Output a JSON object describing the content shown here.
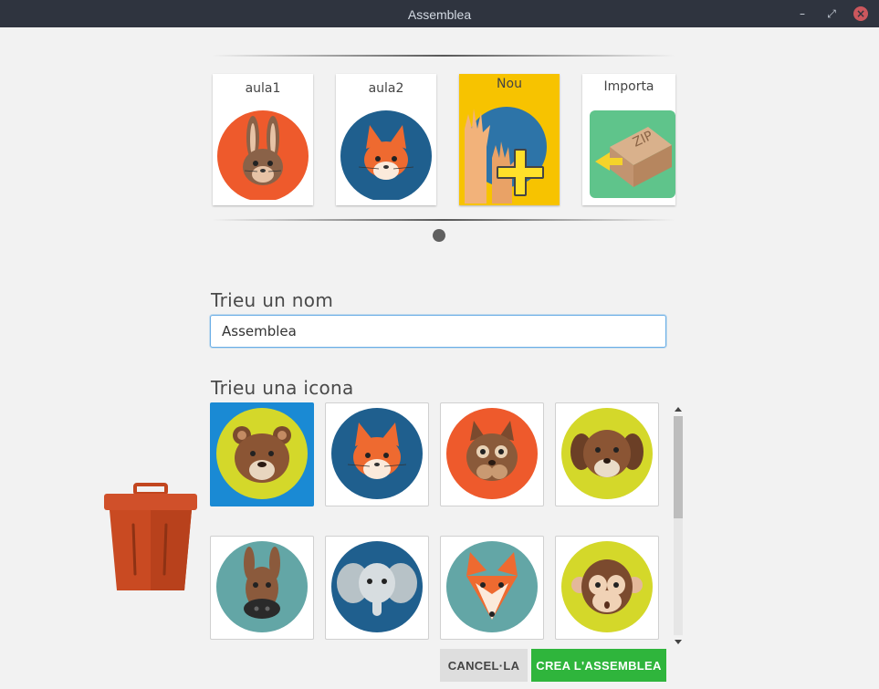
{
  "window": {
    "title": "Assemblea",
    "controls": [
      "minimize-icon",
      "maximize-icon",
      "close-icon"
    ]
  },
  "projects": [
    {
      "label": "aula1",
      "icon": "rabbit-icon"
    },
    {
      "label": "aula2",
      "icon": "fox-icon"
    },
    {
      "label": "Nou",
      "icon": "new-hands-plus-icon"
    },
    {
      "label": "Importa",
      "icon": "zip-import-icon"
    }
  ],
  "name_section": {
    "title": "Trieu un nom",
    "value": "Assemblea"
  },
  "icon_section": {
    "title": "Trieu una icona",
    "icons": [
      "bear-icon",
      "fox-icon",
      "squirrel-icon",
      "dog-icon",
      "donkey-icon",
      "elephant-icon",
      "fox-light-icon",
      "monkey-icon"
    ],
    "selected": "bear-icon"
  },
  "buttons": {
    "cancel": "CANCEL·LA",
    "create": "CREA L'ASSEMBLEA"
  },
  "colors": {
    "selected_tile": "#1a8ad4",
    "create_button": "#2fb53c",
    "new_card": "#f7c300",
    "input_focus": "#6aaee6"
  }
}
